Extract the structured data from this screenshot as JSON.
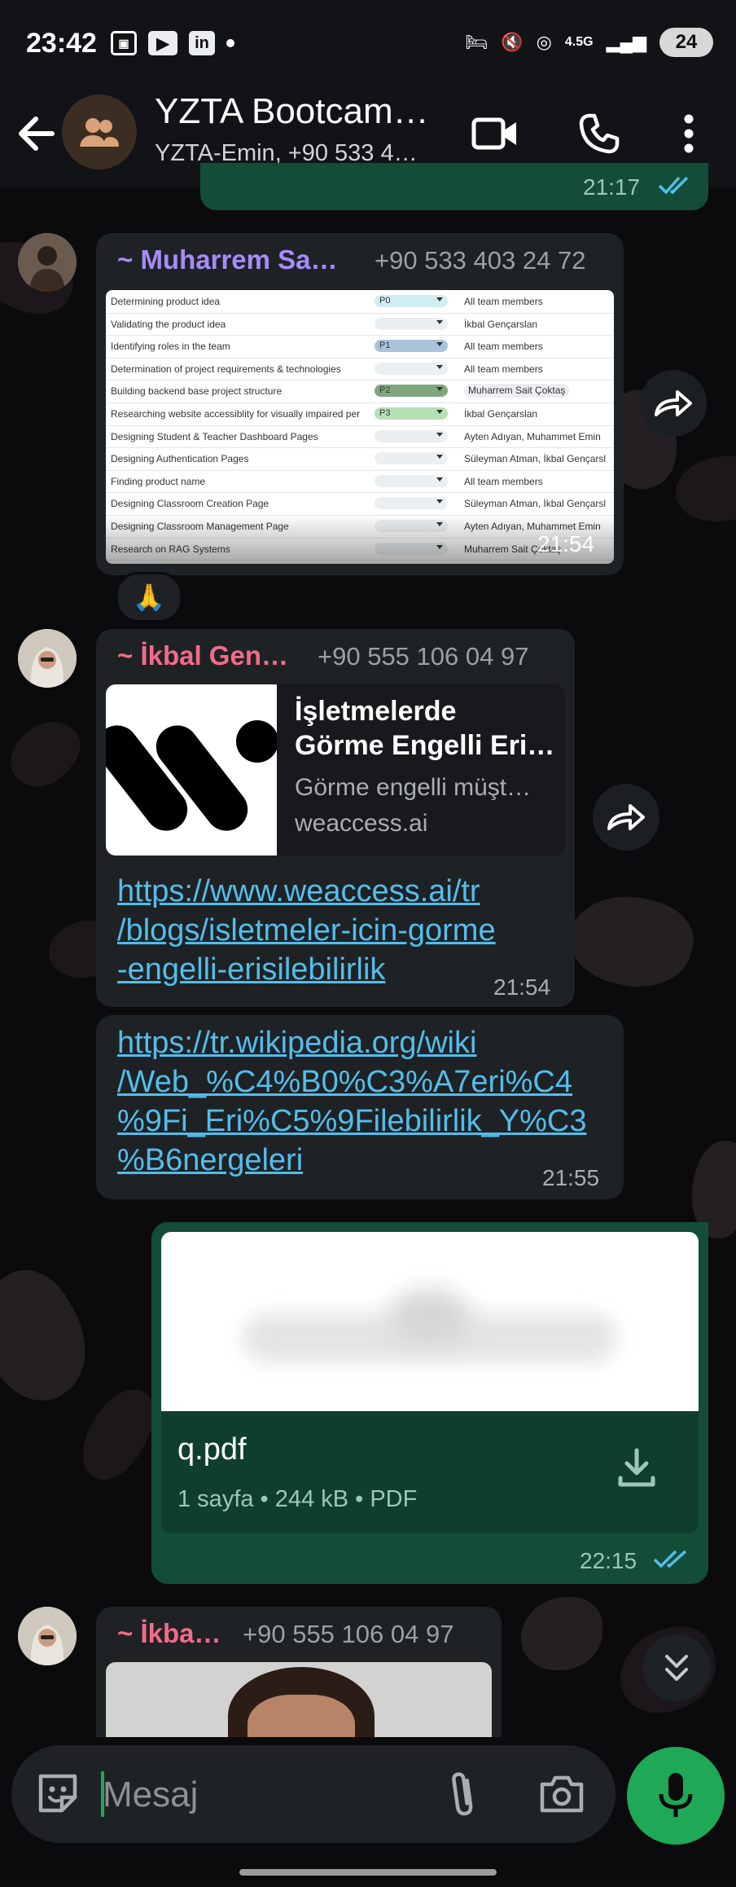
{
  "status_bar": {
    "time": "23:42",
    "network": "4.5G",
    "battery": "24",
    "icons": [
      "screenshot-icon",
      "youtube-icon",
      "linkedin-icon",
      "dot-icon",
      "sleep-icon",
      "mute-icon",
      "hotspot-icon",
      "network-icon",
      "signal-icon",
      "battery-icon"
    ]
  },
  "header": {
    "title": "YZTA Bootcam…",
    "subtitle": "YZTA-Emin, +90 533 4…",
    "icons": [
      "back-arrow-icon",
      "group-avatar-icon",
      "video-call-icon",
      "phone-call-icon",
      "more-vert-icon"
    ]
  },
  "messages": {
    "prev_time": "21:17",
    "m1": {
      "sender": "~ Muharrem Sa…",
      "phone": "+90 533 403 24 72",
      "time": "21:54",
      "reaction": "🙏",
      "table": [
        {
          "task": "Determining  product idea",
          "priority": "P0",
          "assignee": "All team members",
          "prio_color": "#cfeef3",
          "chip": false
        },
        {
          "task": "Validating the product idea",
          "priority": "",
          "assignee": "İkbal Gençarslan",
          "prio_color": "#eceff1",
          "chip": false
        },
        {
          "task": "Identifying roles in the team",
          "priority": "P1",
          "assignee": "All team members",
          "prio_color": "#a9c3da",
          "chip": false
        },
        {
          "task": "Determination of project requirements & technologies",
          "priority": "",
          "assignee": "All team members",
          "prio_color": "#eceff1",
          "chip": false
        },
        {
          "task": "Building backend base project structure",
          "priority": "P2",
          "assignee": "Muharrem Sait Çoktaş",
          "prio_color": "#7fa77f",
          "chip": true
        },
        {
          "task": "Researching website accessiblity for visually impaired per",
          "priority": "P3",
          "assignee": "İkbal Gençarslan",
          "prio_color": "#b7e1b4",
          "chip": false
        },
        {
          "task": "Designing Student & Teacher Dashboard Pages",
          "priority": "",
          "assignee": "Ayten Adıyan, Muhammet Emin",
          "prio_color": "#eceff1",
          "chip": false
        },
        {
          "task": "Designing Authentication Pages",
          "priority": "",
          "assignee": "Süleyman Atman, İkbal Gençarsl",
          "prio_color": "#eceff1",
          "chip": false
        },
        {
          "task": "Finding product name",
          "priority": "",
          "assignee": "All team members",
          "prio_color": "#eceff1",
          "chip": false
        },
        {
          "task": "Designing Classroom Creation Page",
          "priority": "",
          "assignee": "Süleyman Atman, İkbal Gençarsl",
          "prio_color": "#eceff1",
          "chip": false
        },
        {
          "task": "Designing Classroom Management Page",
          "priority": "",
          "assignee": "Ayten Adıyan, Muhammet Emin",
          "prio_color": "#eceff1",
          "chip": false
        },
        {
          "task": "Research on RAG Systems",
          "priority": "",
          "assignee": "Muharrem Sait Çoktaş",
          "prio_color": "#eceff1",
          "chip": false
        }
      ]
    },
    "m2": {
      "sender": "~ İkbal Gen…",
      "phone": "+90 555 106 04 97",
      "preview_title_1": "İşletmelerde",
      "preview_title_2": "Görme Engelli Eri…",
      "preview_desc": "Görme engelli müşt…",
      "preview_domain": "weaccess.ai",
      "link_1": "https://www.weaccess.ai/tr",
      "link_2": "/blogs/isletmeler-icin-gorme",
      "link_3": "-engelli-erisilebilirlik",
      "time": "21:54"
    },
    "m3": {
      "link_1": "https://tr.wikipedia.org/wiki",
      "link_2": "/Web_%C4%B0%C3%A7eri%C4",
      "link_3": "%9Fi_Eri%C5%9Filebilirlik_Y%C3",
      "link_4": "%B6nergeleri",
      "time": "21:55"
    },
    "m4": {
      "file_name": "q.pdf",
      "file_meta": "1 sayfa • 244 kB • PDF",
      "time": "22:15"
    },
    "m5": {
      "sender": "~ İkba…",
      "phone": "+90 555 106 04 97"
    }
  },
  "input": {
    "placeholder": "Mesaj"
  },
  "colors": {
    "accent_green": "#1fa855",
    "link_blue": "#53bdeb",
    "sender_purple": "#a78bfa",
    "sender_pink": "#f26b8a",
    "outgoing_bubble": "#134d37",
    "incoming_bubble": "#1f2225"
  }
}
